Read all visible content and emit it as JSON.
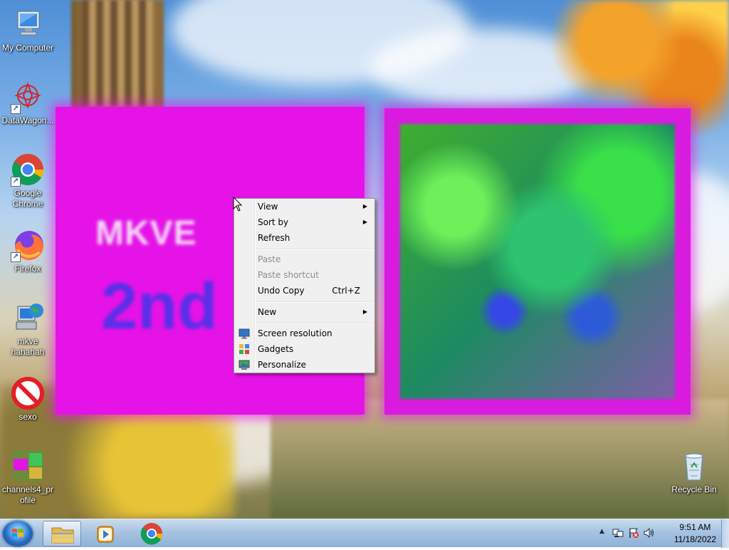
{
  "desktop_icons": [
    {
      "label": "My Computer",
      "icon": "computer-icon"
    },
    {
      "label": "DataWagon...",
      "icon": "datawagon-icon"
    },
    {
      "label": "Google Chrome",
      "icon": "chrome-icon"
    },
    {
      "label": "Firefox",
      "icon": "firefox-icon"
    },
    {
      "label": "mkve hahahah",
      "icon": "network-computer-icon"
    },
    {
      "label": "sexo",
      "icon": "no-entry-icon"
    },
    {
      "label": "channels4_profile",
      "icon": "image-thumbnail-icon"
    },
    {
      "label": "Recycle Bin",
      "icon": "recycle-bin-icon"
    }
  ],
  "gadgets": {
    "left_text_line1": "MKVE",
    "left_text_line2": "2nd"
  },
  "context_menu": {
    "items": [
      {
        "label": "View",
        "submenu": true,
        "enabled": true
      },
      {
        "label": "Sort by",
        "submenu": true,
        "enabled": true
      },
      {
        "label": "Refresh",
        "enabled": true
      },
      {
        "label": "Paste",
        "enabled": false
      },
      {
        "label": "Paste shortcut",
        "enabled": false
      },
      {
        "label": "Undo Copy",
        "shortcut": "Ctrl+Z",
        "enabled": true
      },
      {
        "label": "New",
        "submenu": true,
        "enabled": true
      },
      {
        "label": "Screen resolution",
        "icon": "display-icon",
        "enabled": true
      },
      {
        "label": "Gadgets",
        "icon": "gadgets-icon",
        "enabled": true
      },
      {
        "label": "Personalize",
        "icon": "personalize-icon",
        "enabled": true
      }
    ]
  },
  "taskbar": {
    "pinned": [
      "file-explorer-icon",
      "media-player-icon",
      "chrome-icon"
    ],
    "clock": {
      "time": "9:51 AM",
      "date": "11/18/2022"
    }
  },
  "colors": {
    "accent": "#3399ff",
    "gadget_magenta": "#e513e7"
  }
}
